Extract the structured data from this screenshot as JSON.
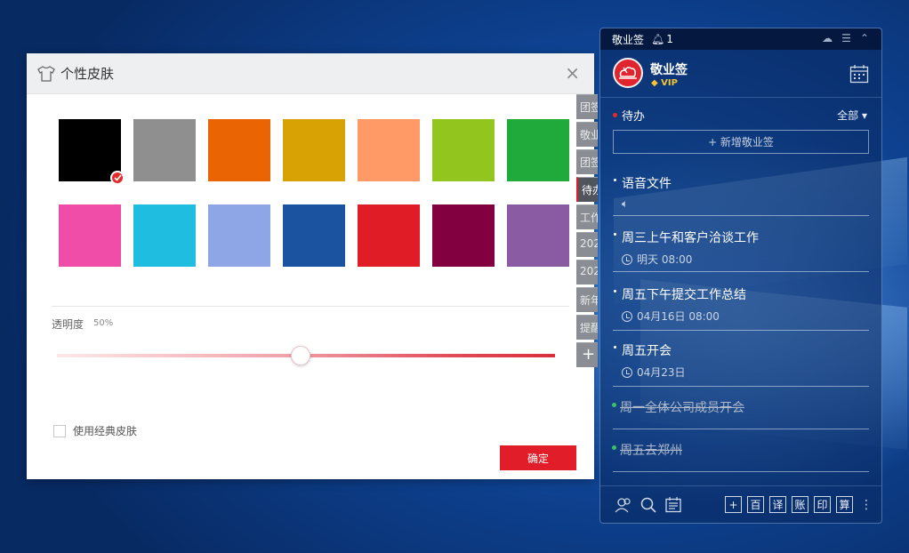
{
  "dialog": {
    "title": "个性皮肤",
    "close": "×",
    "swatches": [
      "#000000",
      "#8f8f8f",
      "#ea6403",
      "#d8a205",
      "#ff9966",
      "#92c51d",
      "#21aa3c",
      "#f04da8",
      "#1fbde0",
      "#8fa6e6",
      "#1c53a0",
      "#e01c26",
      "#830040",
      "#8a5aa3"
    ],
    "selected_index": 0,
    "opacity_label": "透明度",
    "opacity_value": "50%",
    "opacity_fraction": 0.5,
    "classic_label": "使用经典皮肤",
    "ok_label": "确定",
    "side_tabs": [
      "团签",
      "敬业",
      "团签",
      "待办",
      "工作",
      "202",
      "202",
      "新年",
      "提醒",
      "+"
    ]
  },
  "panel": {
    "topbar_title": "敬业签",
    "bell_count": "1",
    "app_name": "敬业签",
    "vip": "VIP",
    "section_title": "待办",
    "filter_label": "全部",
    "new_note": "+ 新增敬业签",
    "notes": [
      {
        "title": "语音文件",
        "sub": "",
        "type": "audio"
      },
      {
        "title": "周三上午和客户洽谈工作",
        "sub": "明天 08:00"
      },
      {
        "title": "周五下午提交工作总结",
        "sub": "04月16日 08:00"
      },
      {
        "title": "周五开会",
        "sub": "04月23日"
      },
      {
        "title": "周一全体公司成员开会",
        "done": true
      },
      {
        "title": "周五去郑州",
        "done": true
      }
    ],
    "tools": [
      "+",
      "百",
      "译",
      "账",
      "印",
      "算"
    ],
    "accent": "#e0252f"
  }
}
